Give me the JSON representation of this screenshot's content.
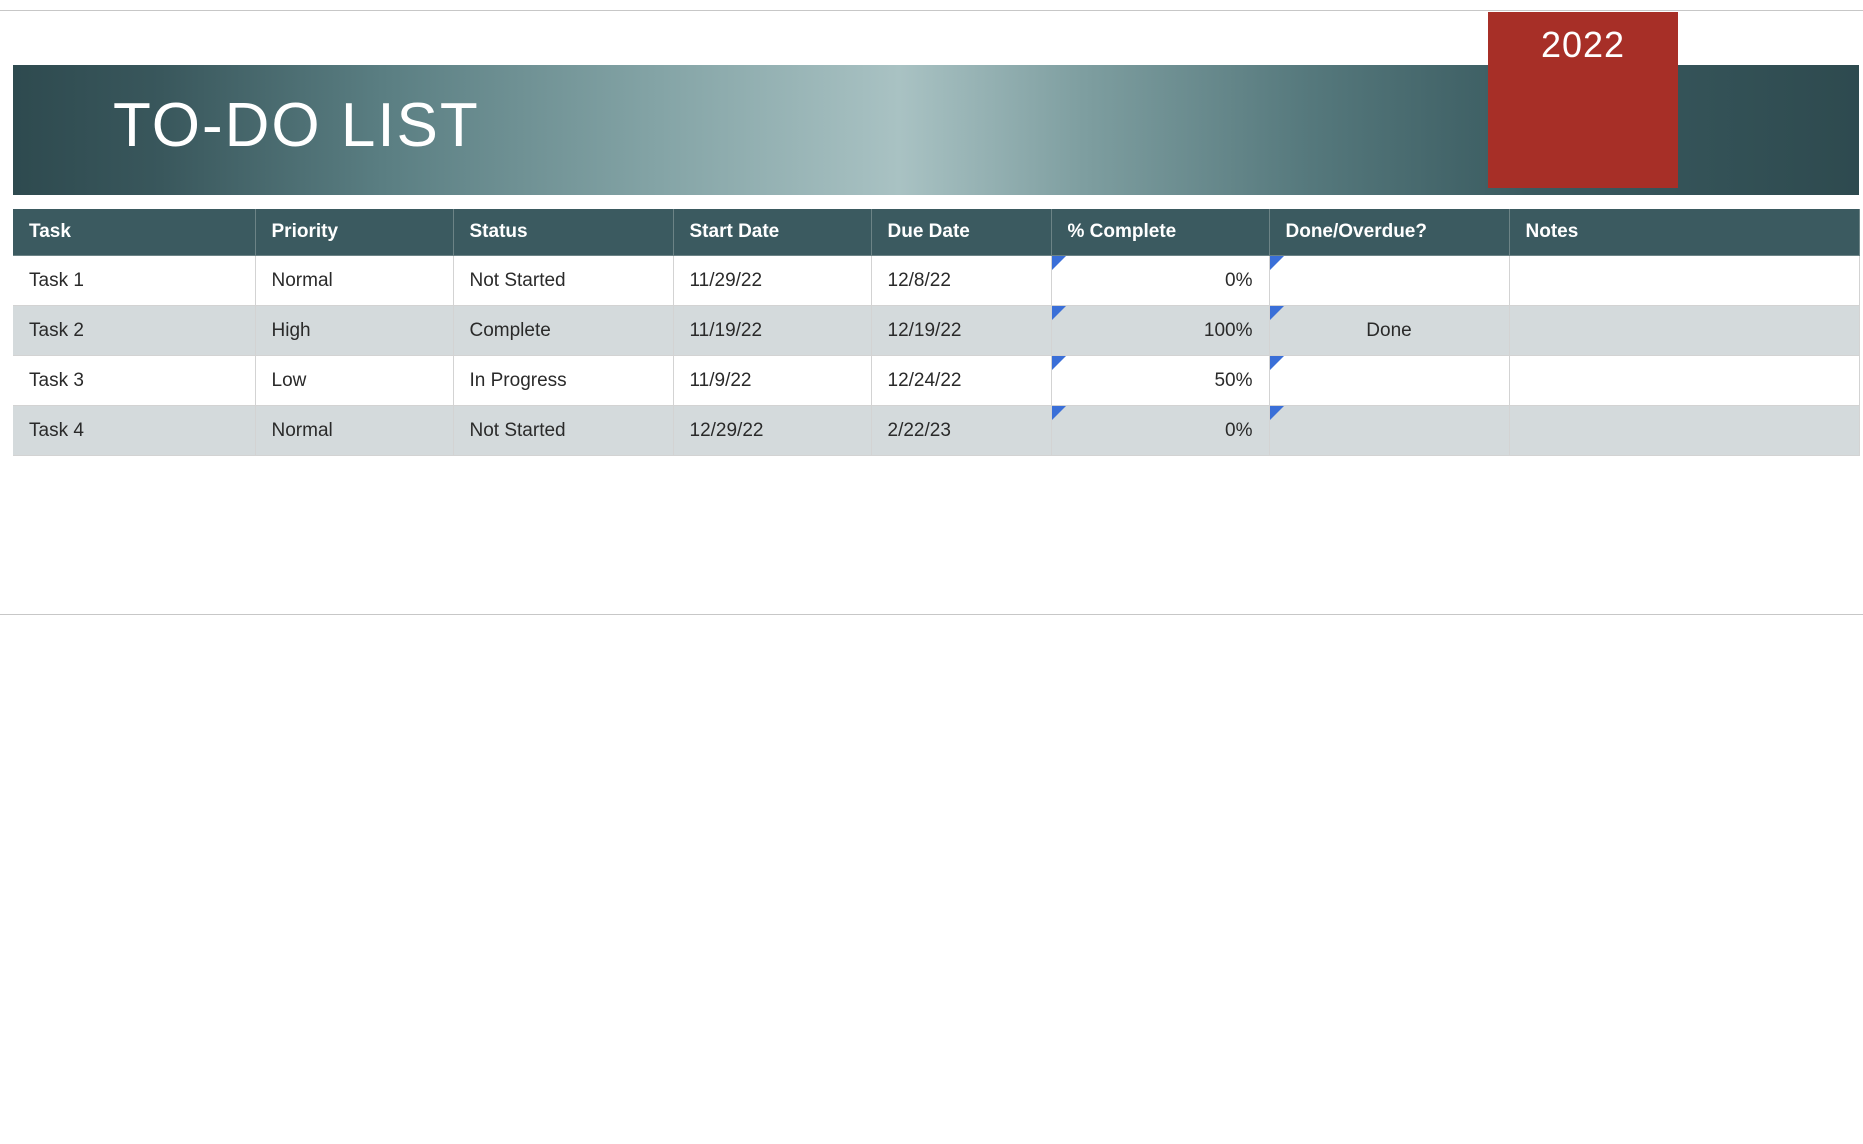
{
  "header": {
    "title": "TO-DO LIST",
    "year": "2022"
  },
  "columns": {
    "task": "Task",
    "priority": "Priority",
    "status": "Status",
    "start": "Start Date",
    "due": "Due Date",
    "pct": "% Complete",
    "done": "Done/Overdue?",
    "notes": "Notes"
  },
  "rows": [
    {
      "task": "Task 1",
      "priority": "Normal",
      "status": "Not Started",
      "start": "11/29/22",
      "due": "12/8/22",
      "pct": "0%",
      "done": "",
      "notes": ""
    },
    {
      "task": "Task 2",
      "priority": "High",
      "status": "Complete",
      "start": "11/19/22",
      "due": "12/19/22",
      "pct": "100%",
      "done": "Done",
      "notes": ""
    },
    {
      "task": "Task 3",
      "priority": "Low",
      "status": "In Progress",
      "start": "11/9/22",
      "due": "12/24/22",
      "pct": "50%",
      "done": "",
      "notes": ""
    },
    {
      "task": "Task 4",
      "priority": "Normal",
      "status": "Not Started",
      "start": "12/29/22",
      "due": "2/22/23",
      "pct": "0%",
      "done": "",
      "notes": ""
    }
  ]
}
